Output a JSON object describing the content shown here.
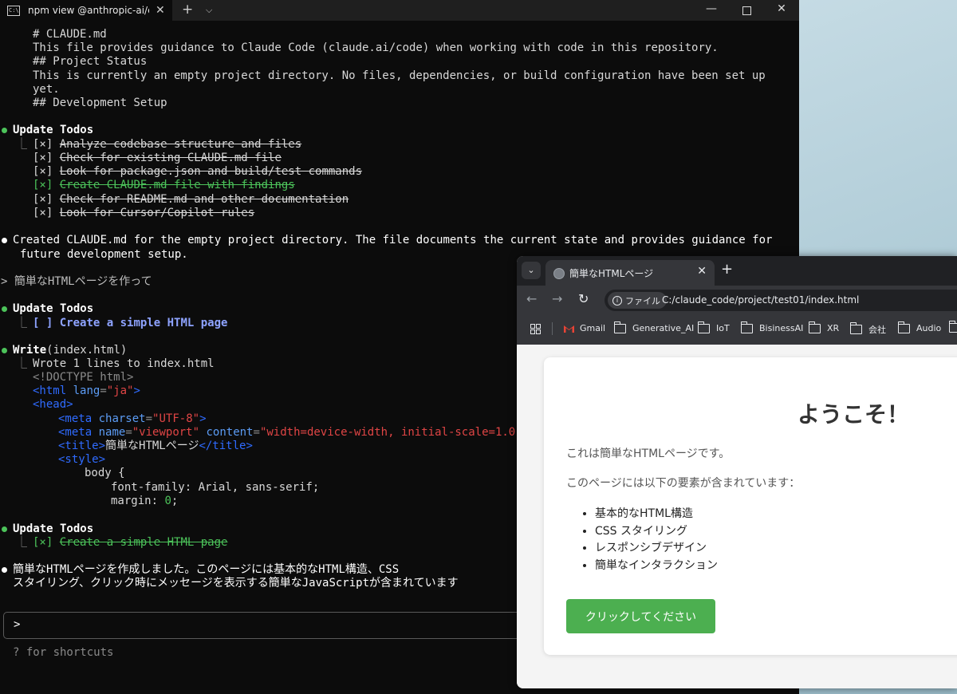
{
  "terminal": {
    "tab_title": "npm view @anthropic-ai/clauc",
    "claude_md_lines": [
      "# CLAUDE.md",
      "This file provides guidance to Claude Code (claude.ai/code) when working with code in this repository.",
      "## Project Status",
      "This is currently an empty project directory. No files, dependencies, or build configuration have been set up",
      "yet.",
      "## Development Setup"
    ],
    "update_todos_1": {
      "heading": "Update Todos",
      "items": [
        "Analyze codebase structure and files",
        "Check for existing CLAUDE.md file",
        "Look for package.json and build/test commands",
        "Create CLAUDE.md file with findings",
        "Check for README.md and other documentation",
        "Look for Cursor/Copilot rules"
      ],
      "checkbox": "[×]"
    },
    "created_message": [
      "Created CLAUDE.md for the empty project directory. The file documents the current state and provides guidance for",
      "future development setup."
    ],
    "user_prompt": "> 簡単なHTMLページを作って",
    "update_todos_2": {
      "heading": "Update Todos",
      "checkbox": "[ ]",
      "item": "Create a simple HTML page"
    },
    "write": {
      "tool": "Write",
      "arg": "(index.html)",
      "wrote": "Wrote 1 lines to index.html",
      "code": {
        "doctype": "<!DOCTYPE html>",
        "html_open": "<html",
        "html_attr": "lang",
        "html_val": "\"ja\"",
        "head": "<head>",
        "meta_open": "<meta",
        "charset_attr": "charset",
        "charset_val": "\"UTF-8\"",
        "name_attr": "name",
        "name_val": "\"viewport\"",
        "content_attr": "content",
        "content_val": "\"width=device-width, initial-scale=1.0\"",
        "title_open": "<title>",
        "title_text": "簡単なHTMLページ",
        "title_close": "</title>",
        "style_open": "<style>",
        "body_sel": "body {",
        "font_family": "font-family: Arial, sans-serif;",
        "margin_prop": "margin: ",
        "margin_val": "0",
        "margin_end": ";"
      }
    },
    "update_todos_3": {
      "heading": "Update Todos",
      "checkbox": "[×]",
      "item": "Create a simple HTML page"
    },
    "final_message": [
      "簡単なHTMLページを作成しました。このページには基本的なHTML構造、CSS",
      "スタイリング、クリック時にメッセージを表示する簡単なJavaScriptが含まれています"
    ],
    "input_prompt": ">",
    "shortcuts_hint": "? for shortcuts"
  },
  "browser": {
    "tab_title": "簡単なHTMLページ",
    "security_chip": "ファイル",
    "url": "C:/claude_code/project/test01/index.html",
    "bookmarks": [
      "Gmail",
      "Generative_AI",
      "IoT",
      "BisinessAI",
      "XR",
      "会社",
      "Audio"
    ],
    "page": {
      "heading": "ようこそ！",
      "intro": "これは簡単なHTMLページです。",
      "list_intro": "このページには以下の要素が含まれています：",
      "list": [
        "基本的なHTML構造",
        "CSS スタイリング",
        "レスポンシブデザイン",
        "簡単なインタラクション"
      ],
      "button_label": "クリックしてください"
    }
  },
  "colors": {
    "terminal_bg": "#0c0c0c",
    "todo_done_green": "#4cc35a",
    "todo_pending_blue": "#8ea3ff",
    "page_button": "#4caf50"
  }
}
